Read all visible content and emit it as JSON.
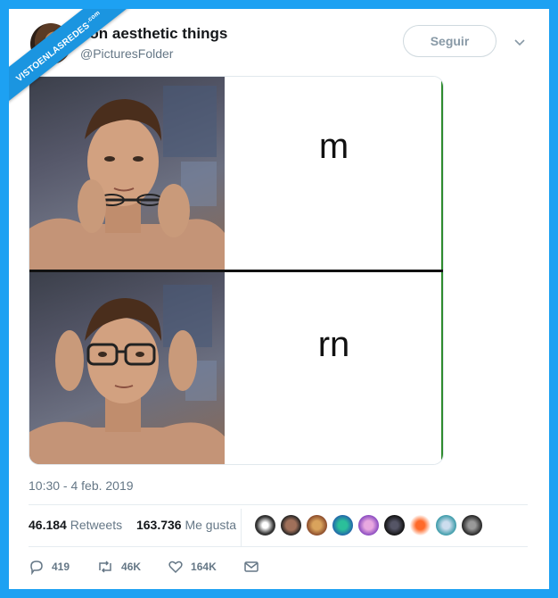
{
  "watermark": {
    "text": "VISTOENLASREDES",
    "suffix": ".com"
  },
  "tweet": {
    "display_name": "non aesthetic things",
    "handle": "@PicturesFolder",
    "follow_label": "Seguir",
    "timestamp": "10:30 - 4 feb. 2019"
  },
  "media": {
    "top_text": "m",
    "bottom_text": "rn"
  },
  "stats": {
    "retweets_count": "46.184",
    "retweets_label": "Retweets",
    "likes_count": "163.736",
    "likes_label": "Me gusta"
  },
  "actions": {
    "replies": "419",
    "retweets": "46K",
    "likes": "164K"
  },
  "colors": {
    "background": "#1da1f2",
    "accent_green": "#2e8b2e",
    "muted": "#657786"
  }
}
